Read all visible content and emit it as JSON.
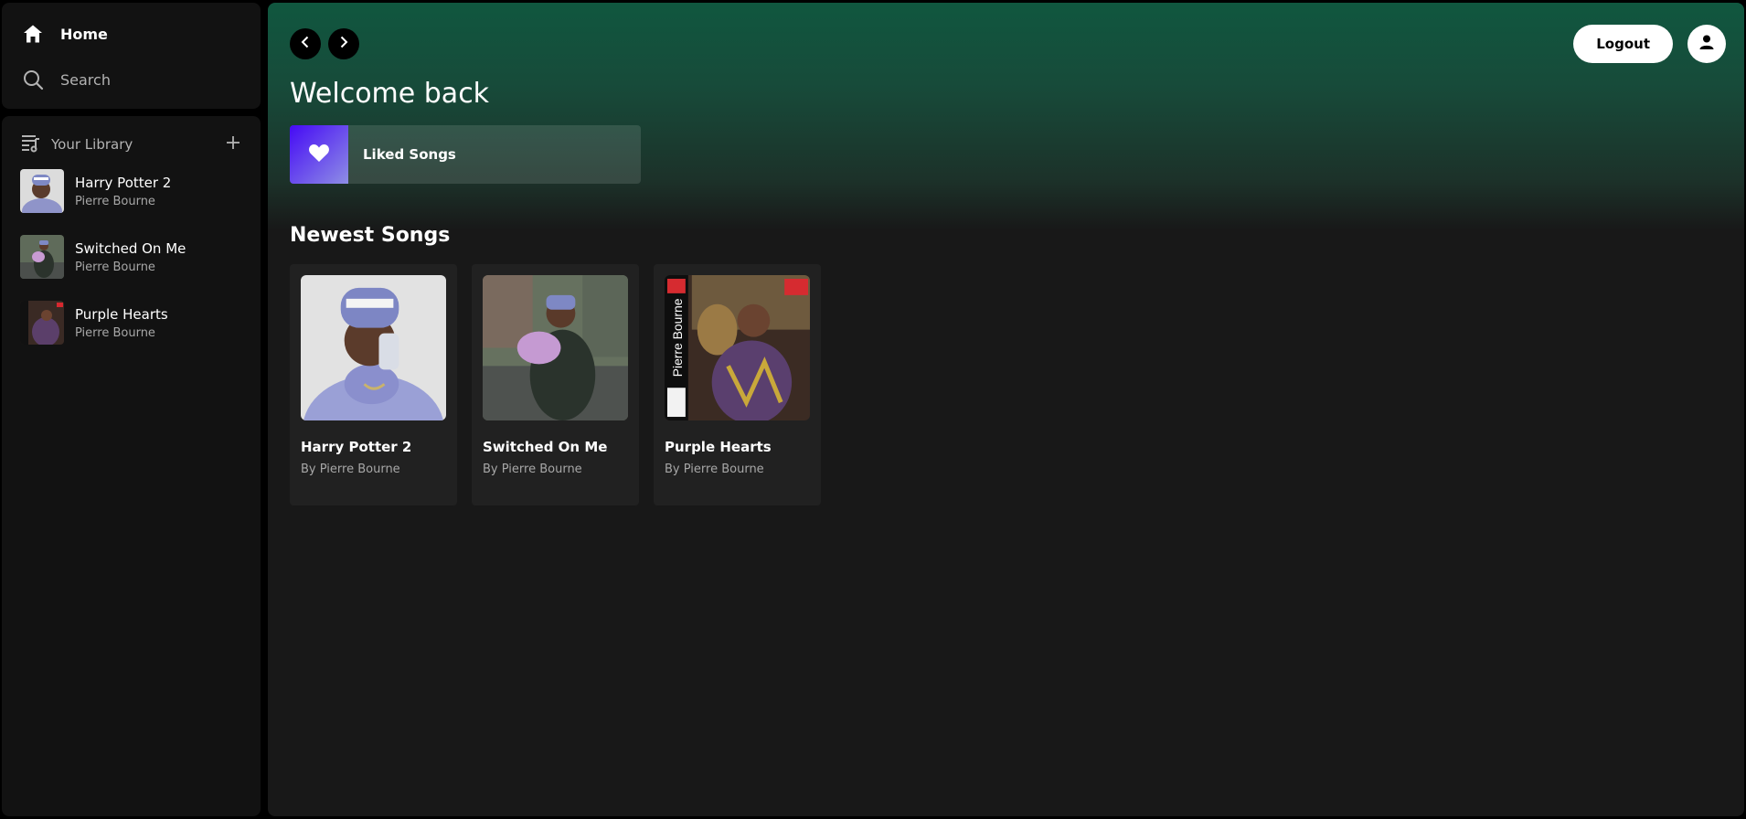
{
  "sidebar": {
    "nav": {
      "home_label": "Home",
      "search_label": "Search"
    },
    "library": {
      "title": "Your Library",
      "items": [
        {
          "name": "Harry Potter 2",
          "artist": "Pierre Bourne"
        },
        {
          "name": "Switched On Me",
          "artist": "Pierre Bourne"
        },
        {
          "name": "Purple Hearts",
          "artist": "Pierre Bourne"
        }
      ]
    }
  },
  "header": {
    "logout_label": "Logout"
  },
  "main": {
    "greeting": "Welcome back",
    "liked_songs_label": "Liked Songs",
    "newest_title": "Newest Songs",
    "cards": [
      {
        "title": "Harry Potter 2",
        "subtitle": "By Pierre Bourne"
      },
      {
        "title": "Switched On Me",
        "subtitle": "By Pierre Bourne"
      },
      {
        "title": "Purple Hearts",
        "subtitle": "By Pierre Bourne",
        "art_text": "Pierre Bourne"
      }
    ]
  },
  "colors": {
    "header_gradient_top": "#10573f",
    "background": "#181818",
    "panel": "#121212",
    "card": "#212121",
    "liked_gradient_start": "#450af5",
    "liked_gradient_end": "#8e8ee5"
  },
  "icons": {
    "home": "home-icon",
    "search": "search-icon",
    "library": "library-icon",
    "add": "plus-icon",
    "back": "chevron-left-icon",
    "forward": "chevron-right-icon",
    "user": "user-icon",
    "liked": "heart-icon"
  }
}
